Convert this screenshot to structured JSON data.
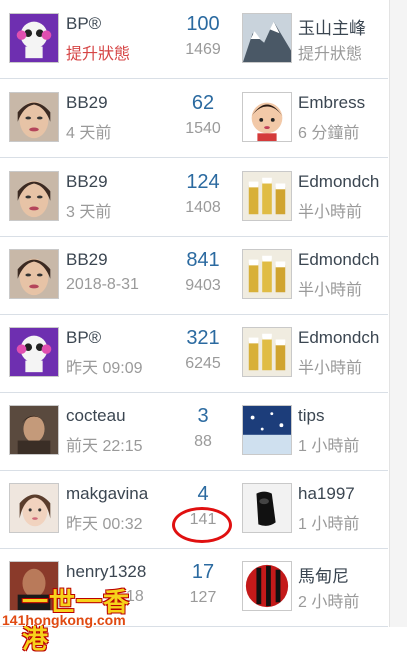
{
  "rows": [
    {
      "l_name": "BP®",
      "l_sub": "提升狀態",
      "l_sub_red": true,
      "count": "100",
      "views": "1469",
      "r_name": "玉山主峰",
      "r_sub": "提升狀態",
      "l_avatar": "panda-avatar",
      "r_avatar": "mountain-avatar"
    },
    {
      "l_name": "BB29",
      "l_sub": "4 天前",
      "count": "62",
      "views": "1540",
      "r_name": "Embress",
      "r_sub": "6 分鐘前",
      "l_avatar": "woman-avatar",
      "r_avatar": "cartoon-girl-avatar"
    },
    {
      "l_name": "BB29",
      "l_sub": "3 天前",
      "count": "124",
      "views": "1408",
      "r_name": "Edmondch",
      "r_sub": "半小時前",
      "l_avatar": "woman-avatar",
      "r_avatar": "beer-avatar"
    },
    {
      "l_name": "BB29",
      "l_sub": "2018-8-31",
      "count": "841",
      "views": "9403",
      "r_name": "Edmondch",
      "r_sub": "半小時前",
      "l_avatar": "woman-avatar",
      "r_avatar": "beer-avatar"
    },
    {
      "l_name": "BP®",
      "l_sub": "昨天 09:09",
      "count": "321",
      "views": "6245",
      "r_name": "Edmondch",
      "r_sub": "半小時前",
      "l_avatar": "panda-avatar",
      "r_avatar": "beer-avatar"
    },
    {
      "l_name": "cocteau",
      "l_sub": "前天 22:15",
      "count": "3",
      "views": "88",
      "r_name": "tips",
      "r_sub": "1 小時前",
      "l_avatar": "man-avatar",
      "r_avatar": "snow-avatar"
    },
    {
      "l_name": "makgavina",
      "l_sub": "昨天 00:32",
      "count": "4",
      "views": "141",
      "r_name": "ha1997",
      "r_sub": "1 小時前",
      "l_avatar": "girl-avatar",
      "r_avatar": "shoe-avatar"
    },
    {
      "l_name": "henry1328",
      "l_sub": "18",
      "count": "17",
      "views": "127",
      "r_name": "馬甸尼",
      "r_sub": "2 小時前",
      "l_avatar": "boxer-avatar",
      "r_avatar": "milan-avatar"
    }
  ],
  "watermark": {
    "top": "一世一香港",
    "bottom": "141hongkong.com"
  }
}
